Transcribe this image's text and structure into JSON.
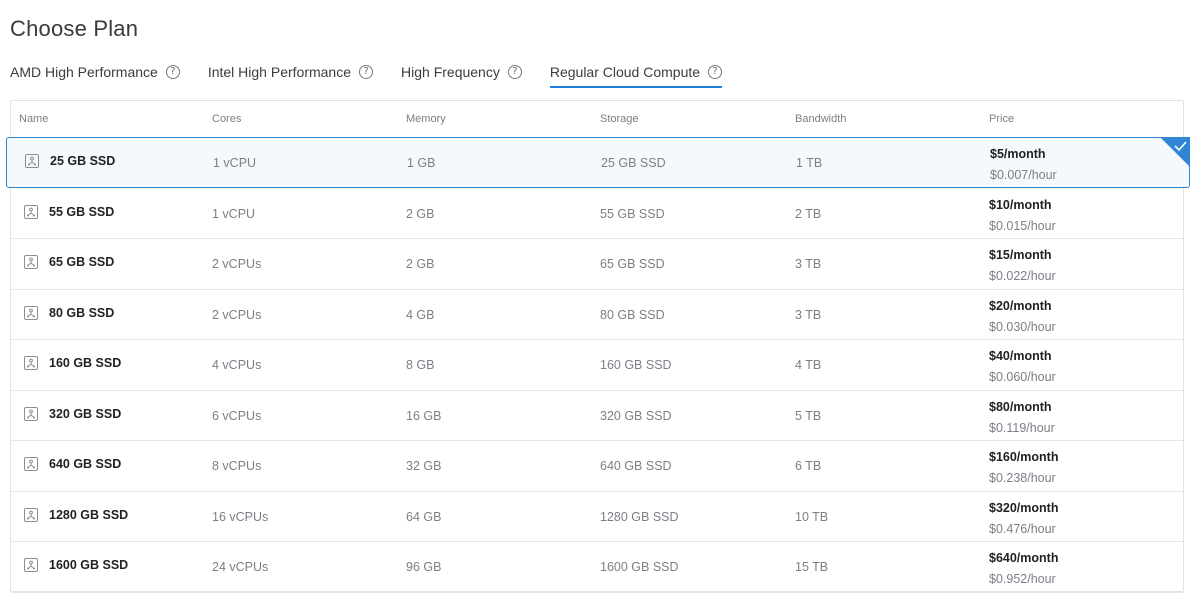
{
  "page": {
    "title": "Choose Plan"
  },
  "tabs": [
    {
      "label": "AMD High Performance",
      "active": false
    },
    {
      "label": "Intel High Performance",
      "active": false
    },
    {
      "label": "High Frequency",
      "active": false
    },
    {
      "label": "Regular Cloud Compute",
      "active": true
    }
  ],
  "table": {
    "headers": {
      "name": "Name",
      "cores": "Cores",
      "memory": "Memory",
      "storage": "Storage",
      "bandwidth": "Bandwidth",
      "price": "Price"
    },
    "rows": [
      {
        "name": "25 GB SSD",
        "cores": "1 vCPU",
        "memory": "1 GB",
        "storage": "25 GB SSD",
        "bandwidth": "1 TB",
        "price_month": "$5/month",
        "price_hour": "$0.007/hour",
        "selected": true
      },
      {
        "name": "55 GB SSD",
        "cores": "1 vCPU",
        "memory": "2 GB",
        "storage": "55 GB SSD",
        "bandwidth": "2 TB",
        "price_month": "$10/month",
        "price_hour": "$0.015/hour",
        "selected": false
      },
      {
        "name": "65 GB SSD",
        "cores": "2 vCPUs",
        "memory": "2 GB",
        "storage": "65 GB SSD",
        "bandwidth": "3 TB",
        "price_month": "$15/month",
        "price_hour": "$0.022/hour",
        "selected": false
      },
      {
        "name": "80 GB SSD",
        "cores": "2 vCPUs",
        "memory": "4 GB",
        "storage": "80 GB SSD",
        "bandwidth": "3 TB",
        "price_month": "$20/month",
        "price_hour": "$0.030/hour",
        "selected": false
      },
      {
        "name": "160 GB SSD",
        "cores": "4 vCPUs",
        "memory": "8 GB",
        "storage": "160 GB SSD",
        "bandwidth": "4 TB",
        "price_month": "$40/month",
        "price_hour": "$0.060/hour",
        "selected": false
      },
      {
        "name": "320 GB SSD",
        "cores": "6 vCPUs",
        "memory": "16 GB",
        "storage": "320 GB SSD",
        "bandwidth": "5 TB",
        "price_month": "$80/month",
        "price_hour": "$0.119/hour",
        "selected": false
      },
      {
        "name": "640 GB SSD",
        "cores": "8 vCPUs",
        "memory": "32 GB",
        "storage": "640 GB SSD",
        "bandwidth": "6 TB",
        "price_month": "$160/month",
        "price_hour": "$0.238/hour",
        "selected": false
      },
      {
        "name": "1280 GB SSD",
        "cores": "16 vCPUs",
        "memory": "64 GB",
        "storage": "1280 GB SSD",
        "bandwidth": "10 TB",
        "price_month": "$320/month",
        "price_hour": "$0.476/hour",
        "selected": false
      },
      {
        "name": "1600 GB SSD",
        "cores": "24 vCPUs",
        "memory": "96 GB",
        "storage": "1600 GB SSD",
        "bandwidth": "15 TB",
        "price_month": "$640/month",
        "price_hour": "$0.952/hour",
        "selected": false
      }
    ]
  },
  "icons": {
    "tab_help": "help-circle-icon",
    "plan": "server-plan-icon",
    "selected_mark": "checkmark-icon"
  },
  "colors": {
    "accent": "#1e7fd6",
    "selected_border": "#2f86d3",
    "selected_bg": "#f4f9fe"
  }
}
